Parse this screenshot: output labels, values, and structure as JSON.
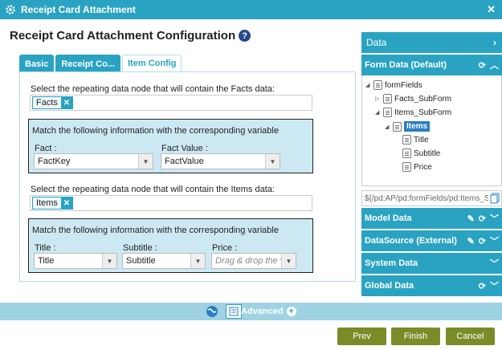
{
  "window": {
    "title": "Receipt Card Attachment"
  },
  "page": {
    "heading": "Receipt Card Attachment Configuration"
  },
  "tabs": [
    {
      "label": "Basic"
    },
    {
      "label": "Receipt Co..."
    },
    {
      "label": "Item Config"
    }
  ],
  "facts": {
    "node_label": "Select the repeating data node that will contain the Facts data:",
    "token": "Facts",
    "match_title": "Match the following information with the corresponding variable",
    "fact_label": "Fact",
    "fact_value": "FactKey",
    "fact_value_label": "Fact Value",
    "fact_value_value": "FactValue"
  },
  "items": {
    "node_label": "Select the repeating data node that will contain the Items data:",
    "token": "Items",
    "match_title": "Match the following information with the corresponding variable",
    "title_label": "Title",
    "title_value": "Title",
    "subtitle_label": "Subtitle",
    "subtitle_value": "Subtitle",
    "price_label": "Price",
    "price_placeholder": "Drag & drop the vari"
  },
  "colon": ":",
  "data_panel": {
    "header": "Data",
    "form_data_label": "Form Data (Default)",
    "tree": [
      {
        "label": "formFields"
      },
      {
        "label": "Facts_SubForm"
      },
      {
        "label": "Items_SubForm"
      },
      {
        "label": "Items"
      },
      {
        "label": "Title"
      },
      {
        "label": "Subtitle"
      },
      {
        "label": "Price"
      }
    ],
    "expression": "${/pd:AP/pd:formFields/pd:Items_Su",
    "sections": [
      {
        "label": "Model Data"
      },
      {
        "label": "DataSource (External)"
      },
      {
        "label": "System Data"
      },
      {
        "label": "Global Data"
      }
    ]
  },
  "footer": {
    "advanced_label": "Advanced",
    "prev_label": "Prev",
    "finish_label": "Finish",
    "cancel_label": "Cancel"
  },
  "colors": {
    "accent": "#2aa3c3",
    "prev": "#7a8c27",
    "finish": "#7a8c27",
    "cancel": "#7a8c27"
  }
}
